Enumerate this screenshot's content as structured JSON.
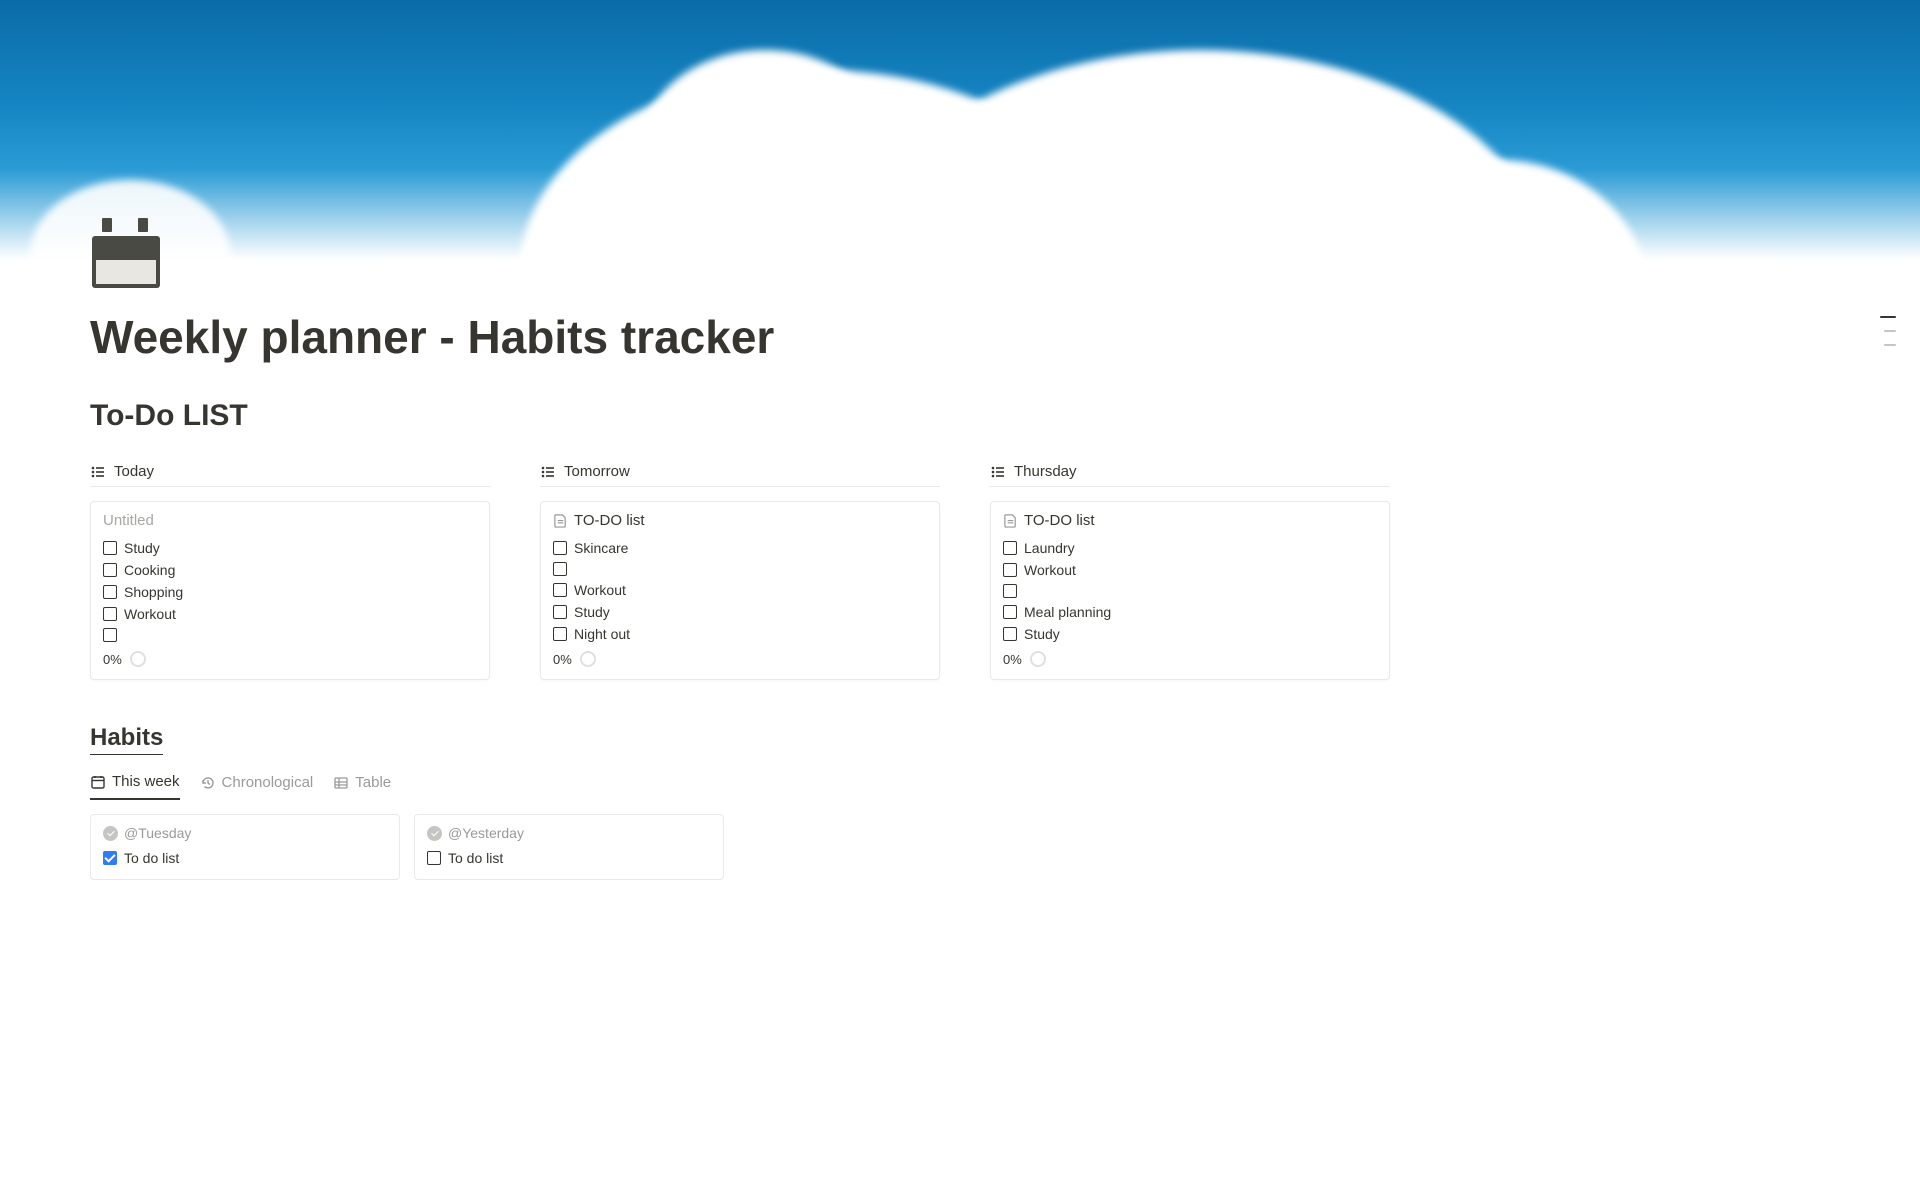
{
  "page": {
    "title": "Weekly planner - Habits tracker"
  },
  "todo": {
    "heading": "To-Do LIST",
    "columns": [
      {
        "view": "Today",
        "cardTitle": "Untitled",
        "untitled": true,
        "items": [
          "Study",
          "Cooking",
          "Shopping",
          "Workout",
          ""
        ],
        "progress": "0%"
      },
      {
        "view": "Tomorrow",
        "cardTitle": "TO-DO list",
        "untitled": false,
        "items": [
          "Skincare",
          "",
          "Workout",
          "Study",
          "Night out"
        ],
        "progress": "0%"
      },
      {
        "view": "Thursday",
        "cardTitle": "TO-DO list",
        "untitled": false,
        "items": [
          "Laundry",
          "Workout",
          "",
          "Meal planning",
          "Study"
        ],
        "progress": "0%"
      }
    ]
  },
  "habits": {
    "heading": "Habits",
    "tabs": [
      "This week",
      "Chronological",
      "Table"
    ],
    "activeTab": 0,
    "cards": [
      {
        "date": "@Tuesday",
        "itemLabel": "To do list",
        "checked": true
      },
      {
        "date": "@Yesterday",
        "itemLabel": "To do list",
        "checked": false
      }
    ]
  }
}
